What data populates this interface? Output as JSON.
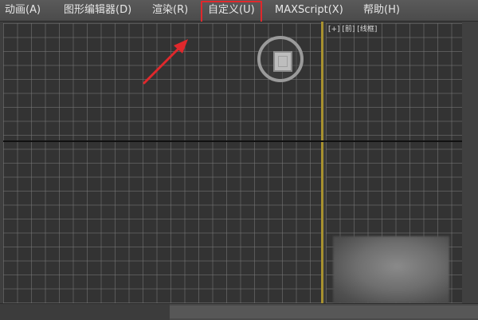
{
  "menu": {
    "items": [
      {
        "label": "动画(A)"
      },
      {
        "label": "图形编辑器(D)"
      },
      {
        "label": "渲染(R)"
      },
      {
        "label": "自定义(U)"
      },
      {
        "label": "MAXScript(X)"
      },
      {
        "label": "帮助(H)"
      }
    ],
    "highlighted_index": 3,
    "highlight_color": "#e0282c"
  },
  "viewport": {
    "label": "[+] [前] [线框]"
  },
  "annotation": {
    "arrow_color": "#e0282c"
  }
}
